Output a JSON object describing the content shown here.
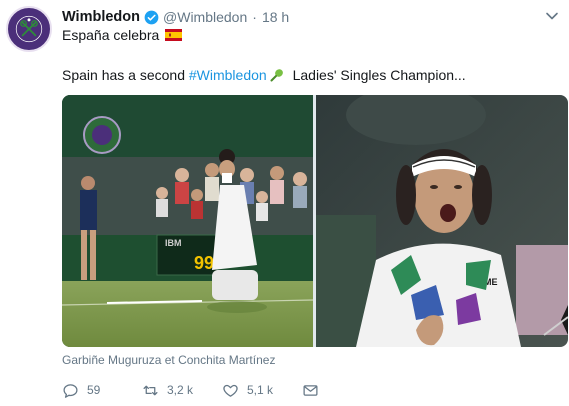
{
  "tweet": {
    "author": {
      "name": "Wimbledon",
      "handle": "@Wimbledon",
      "verified": true,
      "avatar_icon": "wimbledon-championships-logo",
      "avatar_text": "THE CHAMPIONSHIPS WIMBLEDON"
    },
    "separator": "·",
    "time": "18 h",
    "line1": "España celebra",
    "line1_icon": "spain-flag-emoji",
    "line2_prefix": "Spain has a second ",
    "line2_hashtag": "#Wimbledon",
    "line2_icon": "tennis-racket-emoji",
    "line2_suffix": " Ladies' Singles Champion...",
    "scoreboard_sponsor": "IBM",
    "scoreboard_number": "99",
    "shirt_text": "KELME",
    "caption": "Garbiñe Muguruza et Conchita Martínez",
    "actions": {
      "reply_count": "59",
      "retweet_count": "3,2 k",
      "like_count": "5,1 k"
    }
  },
  "colors": {
    "text": "#14171a",
    "secondary": "#657786",
    "link": "#1b95e0",
    "verified": "#1da1f2",
    "wimbledon_purple": "#4b2f7a",
    "wimbledon_green": "#2e6b3a"
  }
}
